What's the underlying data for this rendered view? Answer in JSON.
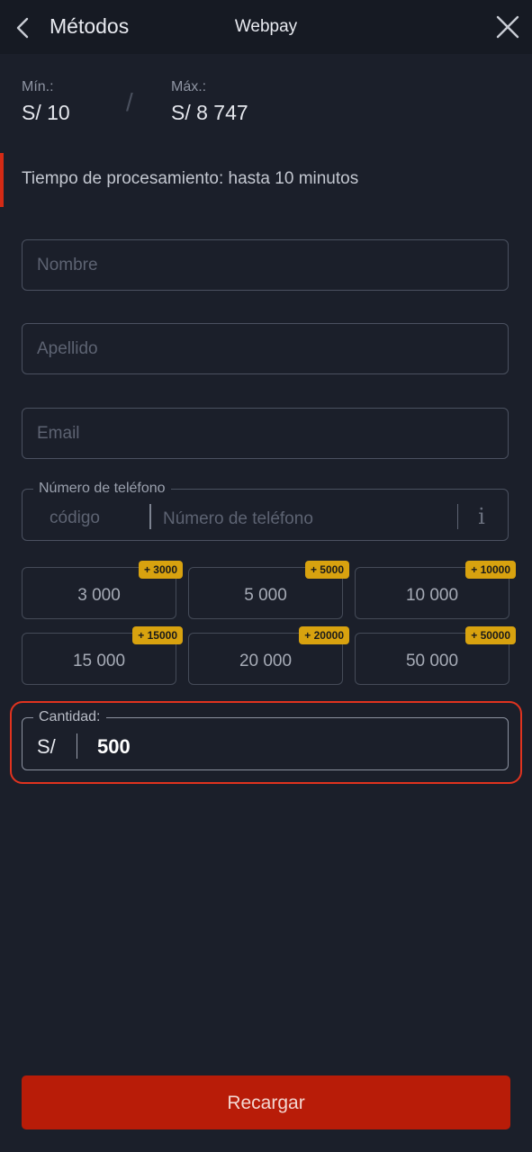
{
  "header": {
    "back_label": "Métodos",
    "center_title": "Webpay"
  },
  "limits": {
    "min_label": "Mín.:",
    "min_value": "S/ 10",
    "separator": "/",
    "max_label": "Máx.:",
    "max_value": "S/ 8 747"
  },
  "processing": {
    "text": "Tiempo de procesamiento: hasta 10 minutos"
  },
  "form": {
    "first_name": {
      "placeholder": "Nombre",
      "value": ""
    },
    "last_name": {
      "placeholder": "Apellido",
      "value": ""
    },
    "email": {
      "placeholder": "Email",
      "value": ""
    },
    "phone": {
      "legend": "Número de teléfono",
      "code_placeholder": "código",
      "number_placeholder": "Número de teléfono",
      "info_glyph": "i"
    }
  },
  "presets": [
    {
      "amount": "3 000",
      "bonus": "+ 3000"
    },
    {
      "amount": "5 000",
      "bonus": "+ 5000"
    },
    {
      "amount": "10 000",
      "bonus": "+ 10000"
    },
    {
      "amount": "15 000",
      "bonus": "+ 15000"
    },
    {
      "amount": "20 000",
      "bonus": "+ 20000"
    },
    {
      "amount": "50 000",
      "bonus": "+ 50000"
    }
  ],
  "amount": {
    "legend": "Cantidad:",
    "currency": "S/",
    "value": "500"
  },
  "submit": {
    "label": "Recargar"
  },
  "colors": {
    "background": "#1b1f2a",
    "accent_red": "#b81c08",
    "highlight_border": "#e1331f",
    "badge": "#d8a20f"
  },
  "icons": {
    "back": "chevron-left-icon",
    "close": "close-icon",
    "info": "info-icon"
  }
}
